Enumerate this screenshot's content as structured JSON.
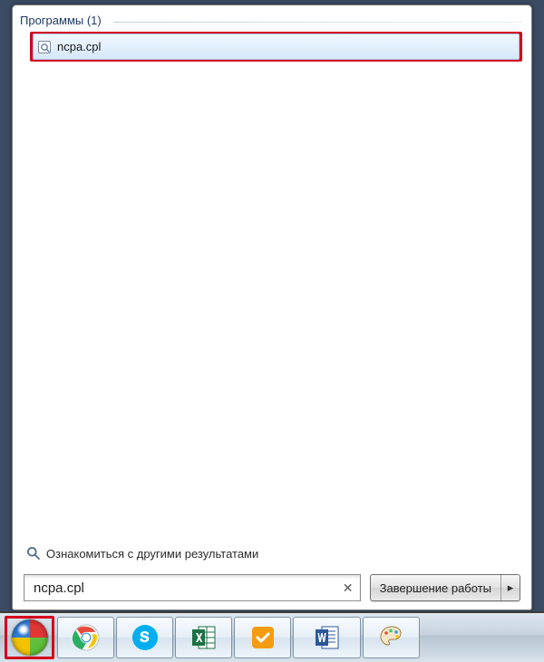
{
  "start_menu": {
    "section_header": "Программы (1)",
    "results": [
      {
        "label": "ncpa.cpl",
        "icon": "control-panel-item-icon"
      }
    ],
    "more_results_label": "Ознакомиться с другими результатами",
    "search_value": "ncpa.cpl",
    "clear_glyph": "✕",
    "shutdown_label": "Завершение работы",
    "shutdown_arrow": "▸"
  },
  "taskbar": {
    "items": [
      {
        "name": "start-button",
        "icon": "windows-orb-icon"
      },
      {
        "name": "chrome-button",
        "icon": "chrome-icon"
      },
      {
        "name": "skype-button",
        "icon": "skype-icon"
      },
      {
        "name": "excel-button",
        "icon": "excel-icon"
      },
      {
        "name": "sticky-button",
        "icon": "sticky-notes-icon"
      },
      {
        "name": "word-button",
        "icon": "word-icon"
      },
      {
        "name": "paint-button",
        "icon": "paint-icon"
      }
    ]
  }
}
